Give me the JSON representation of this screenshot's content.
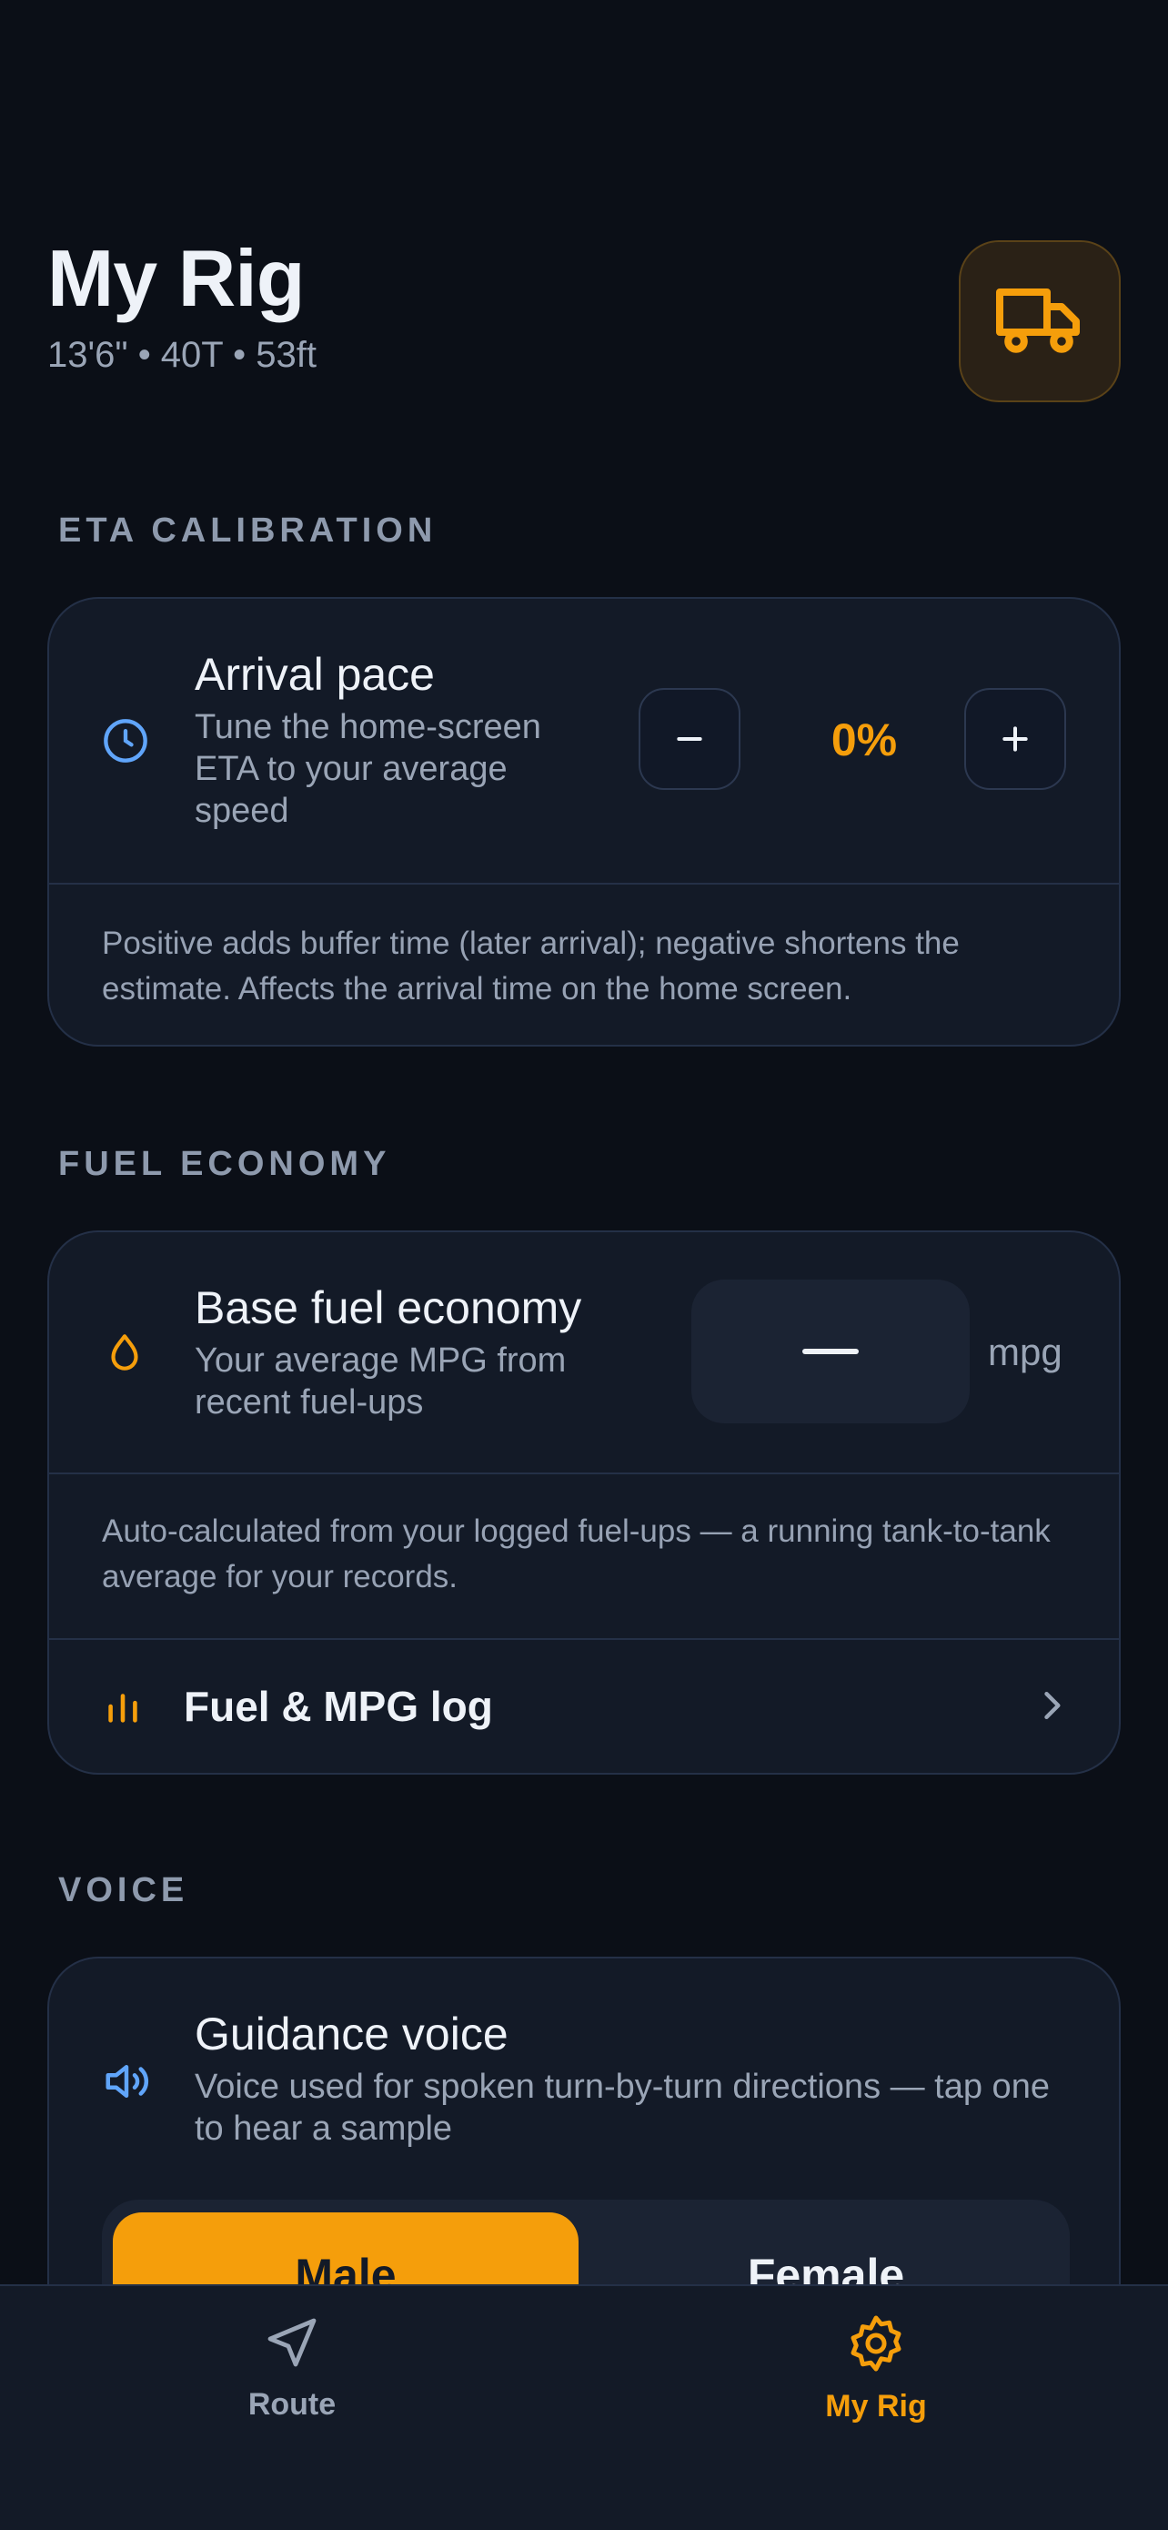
{
  "header": {
    "title": "My Rig",
    "subtitle": "13'6\" • 40T • 53ft",
    "truck_icon": "truck-icon"
  },
  "eta": {
    "section_label": "ETA CALIBRATION",
    "title": "Arrival pace",
    "description": "Tune the home-screen ETA to your average speed",
    "value": "0%",
    "note": "Positive adds buffer time (later arrival); negative shortens the estimate. Affects the arrival time on the home screen.",
    "icon": "clock-icon"
  },
  "fuel": {
    "section_label": "FUEL ECONOMY",
    "title": "Base fuel economy",
    "description": "Your average MPG from recent fuel-ups",
    "value": "—",
    "unit": "mpg",
    "note": "Auto-calculated from your logged fuel-ups — a running tank-to-tank average for your records.",
    "link_label": "Fuel & MPG log",
    "icon": "droplet-icon"
  },
  "voice": {
    "section_label": "VOICE",
    "title": "Guidance voice",
    "description": "Voice used for spoken turn-by-turn directions — tap one to hear a sample",
    "options": [
      "Male",
      "Female"
    ],
    "selected": "Male",
    "icon": "speaker-icon"
  },
  "tabs": [
    {
      "label": "Route",
      "icon": "navigation-arrow-icon"
    },
    {
      "label": "My Rig",
      "icon": "gear-icon"
    }
  ],
  "colors": {
    "accent": "#f59e0b",
    "background": "#0b0f17",
    "card": "#131a27",
    "clock_icon": "#60a5fa"
  }
}
